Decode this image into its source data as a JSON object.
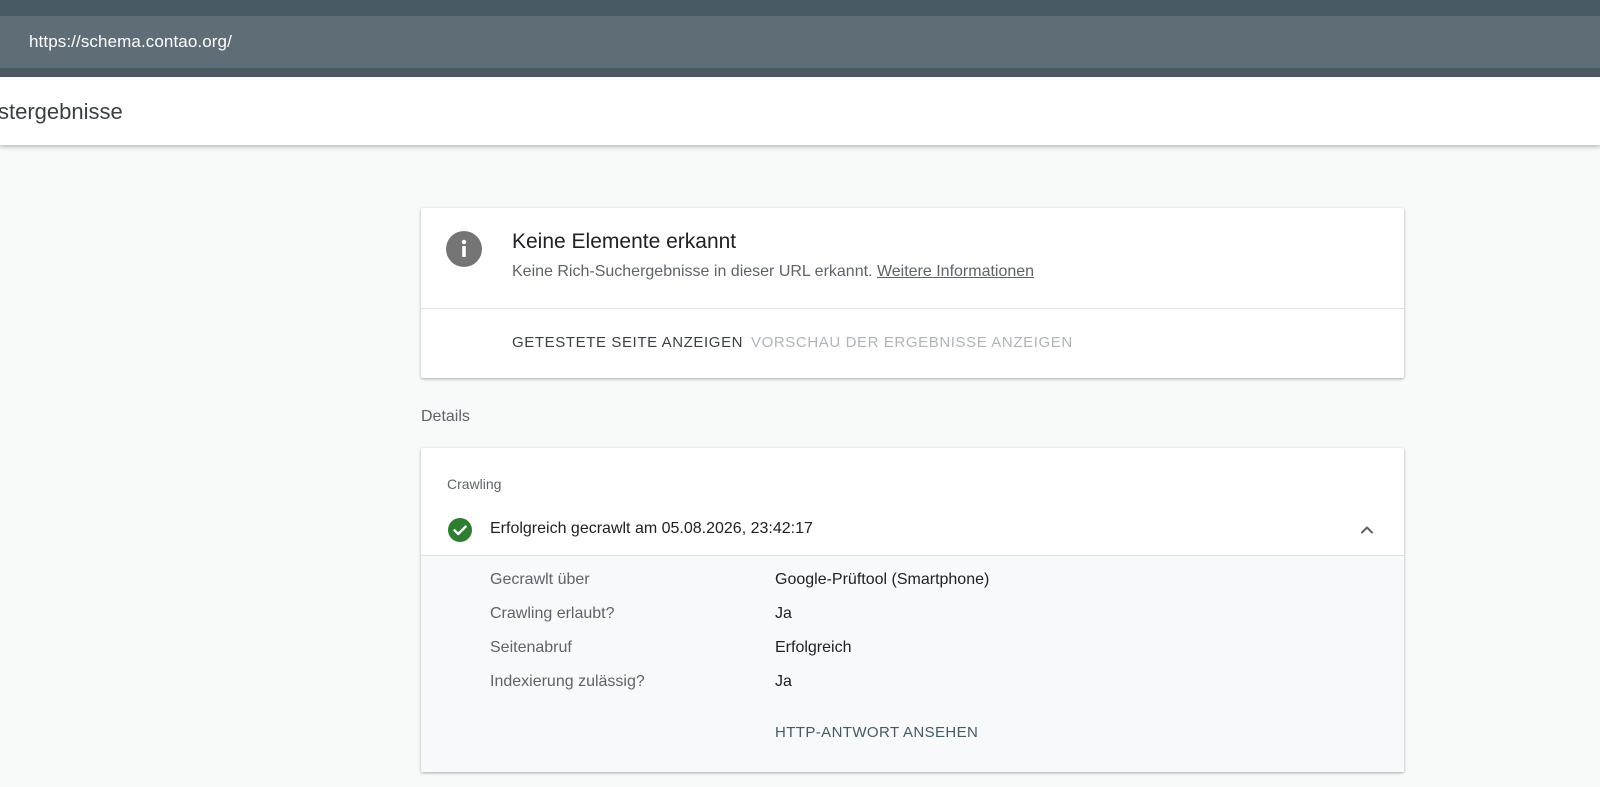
{
  "browser": {
    "url": "https://schema.contao.org/"
  },
  "header": {
    "title": "stergebnisse"
  },
  "result": {
    "icon": "info-icon",
    "title": "Keine Elemente erkannt",
    "subtitle": "Keine Rich-Suchergebnisse in dieser URL erkannt.",
    "more_info_link": "Weitere Informationen",
    "actions": {
      "tested_page": "GETESTETE SEITE ANZEIGEN",
      "preview": "VORSCHAU DER ERGEBNISSE ANZEIGEN"
    }
  },
  "details": {
    "heading": "Details",
    "crawling": {
      "label": "Crawling",
      "status_icon": "check-circle-icon",
      "status": "Erfolgreich gecrawlt am 05.08.2026, 23:42:17",
      "rows": [
        {
          "key": "Gecrawlt über",
          "value": "Google-Prüftool (Smartphone)"
        },
        {
          "key": "Crawling erlaubt?",
          "value": "Ja"
        },
        {
          "key": "Seitenabruf",
          "value": "Erfolgreich"
        },
        {
          "key": "Indexierung zulässig?",
          "value": "Ja"
        }
      ],
      "http_response_button": "HTTP-ANTWORT ANSEHEN"
    }
  },
  "colors": {
    "top_bar": "#4a5a64",
    "url_bar": "#5f6d77",
    "success_green": "#2e7d32",
    "info_grey": "#757575"
  }
}
